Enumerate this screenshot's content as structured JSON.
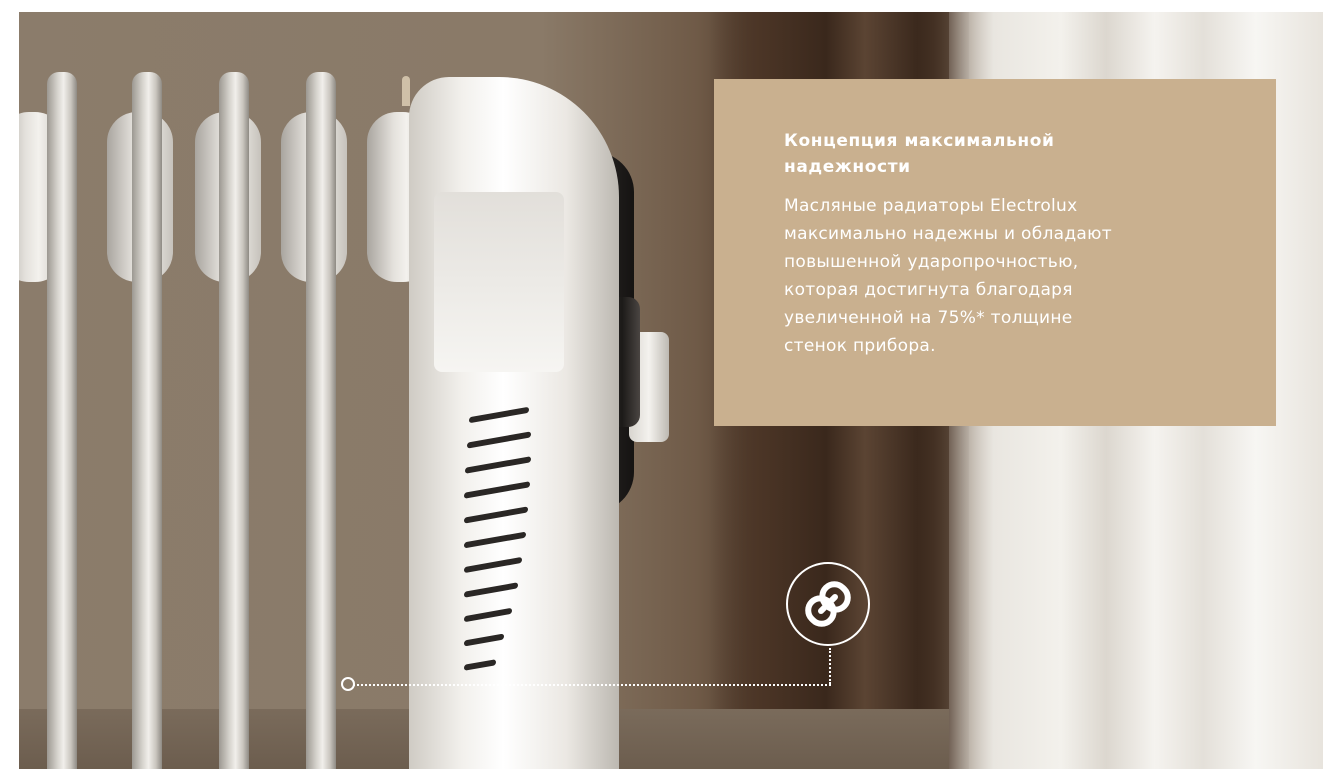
{
  "info": {
    "title_line1": "Концепция максимальной",
    "title_line2": "надежности",
    "body_lines": [
      "Масляные радиаторы Electrolux",
      "максимально надежны и обладают",
      "повышенной ударопрочностью,",
      "которая достигнута благодаря",
      "увеличенной  на 75%* толщине",
      "стенок прибора."
    ]
  },
  "colors": {
    "info_bg": "#c9b08f",
    "text": "#ffffff"
  },
  "icons": {
    "feature_icon": "link-icon"
  }
}
